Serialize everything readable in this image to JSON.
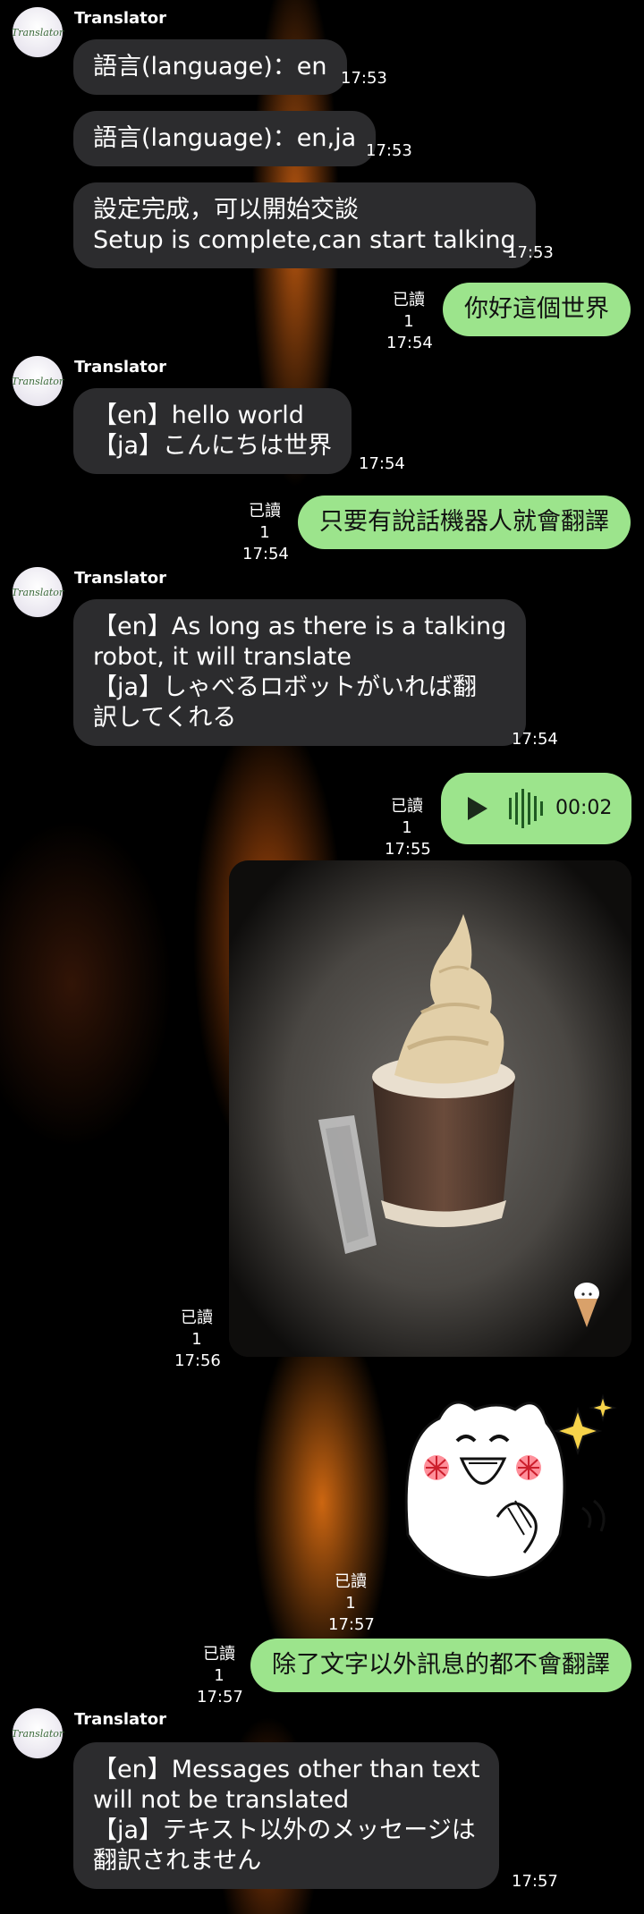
{
  "bot": {
    "name": "Translator",
    "avatar_text": "Translator"
  },
  "read_label": "已讀 1",
  "messages": [
    {
      "text": "語言(language)：en",
      "time": "17:53"
    },
    {
      "text": "語言(language)：en,ja",
      "time": "17:53"
    },
    {
      "text": "設定完成，可以開始交談\nSetup is complete,can start talking",
      "time": "17:53"
    },
    {
      "text": "你好這個世界",
      "time": "17:54"
    },
    {
      "text": "【en】hello world\n【ja】こんにちは世界",
      "time": "17:54"
    },
    {
      "text": "只要有說話機器人就會翻譯",
      "time": "17:54"
    },
    {
      "text": "【en】As long as there is a talking\nrobot, it will translate\n【ja】しゃべるロボットがいれば翻\n訳してくれる",
      "time": "17:54"
    },
    {
      "duration": "00:02",
      "time": "17:55"
    },
    {
      "time": "17:56"
    },
    {
      "time": "17:57"
    },
    {
      "text": "除了文字以外訊息的都不會翻譯",
      "time": "17:57"
    },
    {
      "text": "【en】Messages other than text\nwill not be translated\n【ja】テキスト以外のメッセージは\n翻訳されません",
      "time": "17:57"
    }
  ],
  "icons": {
    "play": "play-icon",
    "waveform": "waveform-icon",
    "photo": "ice-cream-photo",
    "sticker": "cat-sticker"
  },
  "colors": {
    "incoming_bubble": "#2c2c2e",
    "outgoing_bubble": "#9ce48c"
  }
}
